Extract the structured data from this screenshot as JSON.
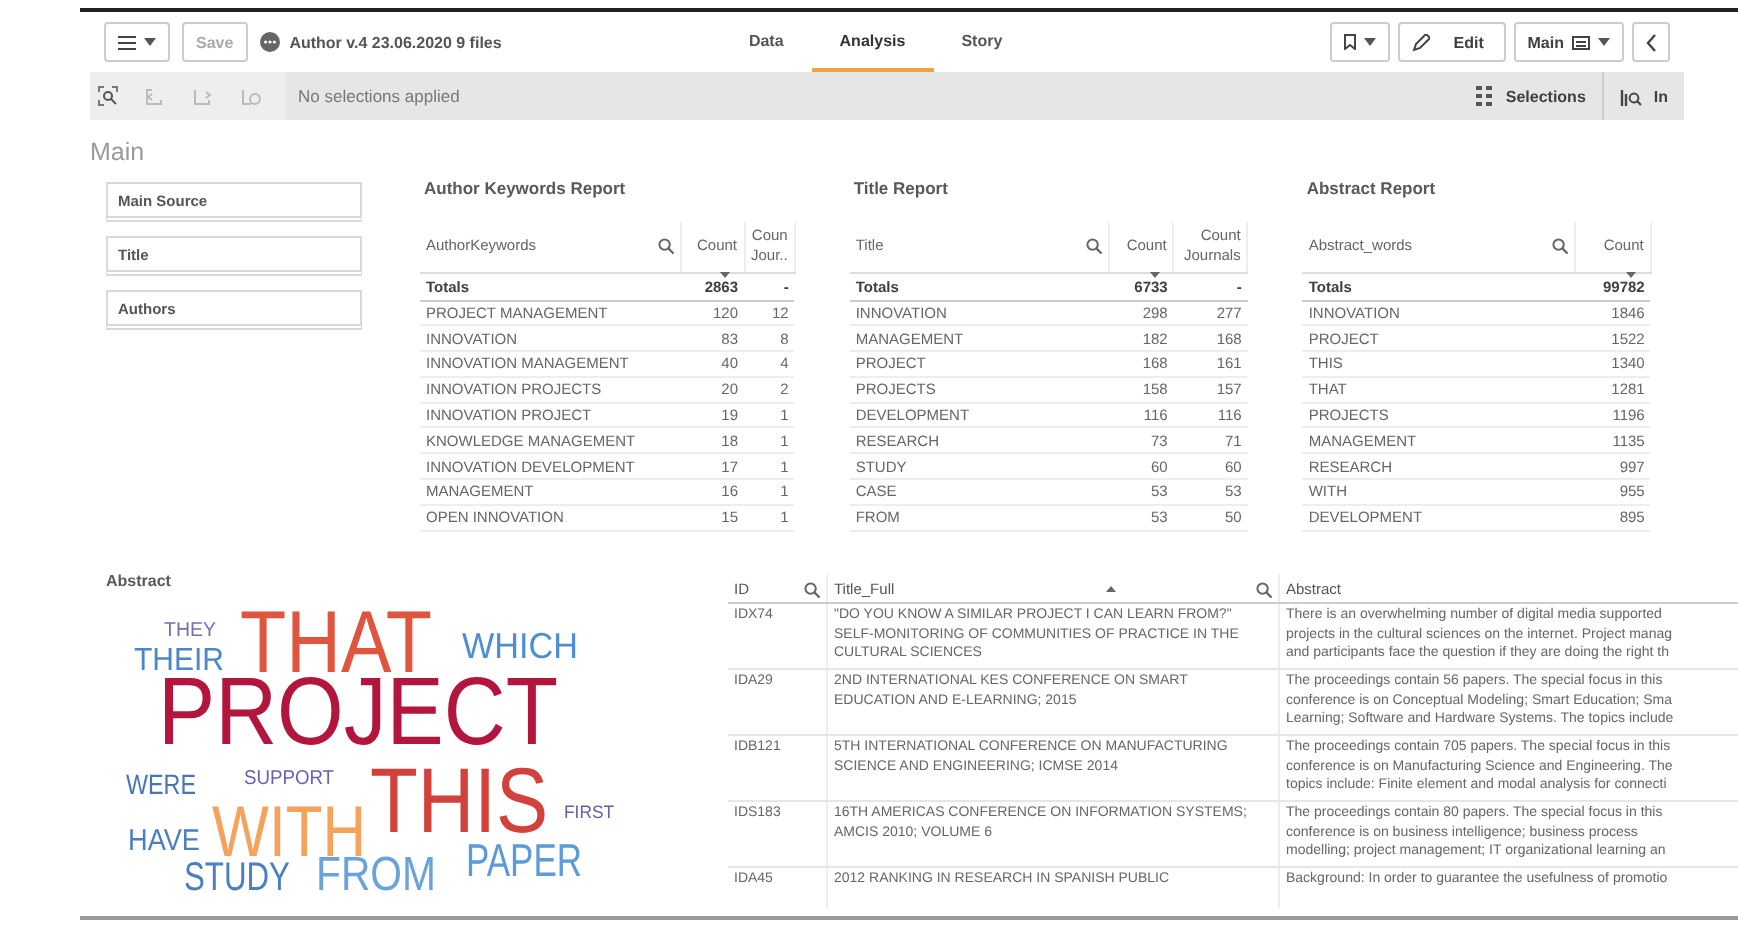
{
  "toolbar": {
    "save": {
      "label": "Save",
      "disabled": true
    },
    "app_title": "Author v.4 23.06.2020 9 files",
    "tabs": [
      {
        "label": "Data",
        "selected": false
      },
      {
        "label": "Analysis",
        "selected": true
      },
      {
        "label": "Story",
        "selected": false
      }
    ],
    "edit": "Edit",
    "sheet": "Main"
  },
  "selection_bar": {
    "status": "No selections applied",
    "selections": "Selections",
    "insights": "In"
  },
  "sheet_title": "Main",
  "filters": [
    "Main Source",
    "Title",
    "Authors"
  ],
  "reports": [
    {
      "title": "Author Keywords Report",
      "columns": [
        "AuthorKeywords",
        "Count",
        "Coun Jour.."
      ],
      "totals": [
        "Totals",
        "2863",
        "-"
      ],
      "rows": [
        [
          "PROJECT MANAGEMENT",
          "120",
          "12"
        ],
        [
          "INNOVATION",
          "83",
          "8"
        ],
        [
          "INNOVATION MANAGEMENT",
          "40",
          "4"
        ],
        [
          "INNOVATION PROJECTS",
          "20",
          "2"
        ],
        [
          "INNOVATION PROJECT",
          "19",
          "1"
        ],
        [
          "KNOWLEDGE MANAGEMENT",
          "18",
          "1"
        ],
        [
          "INNOVATION DEVELOPMENT",
          "17",
          "1"
        ],
        [
          "MANAGEMENT",
          "16",
          "1"
        ],
        [
          "OPEN INNOVATION",
          "15",
          "1"
        ]
      ]
    },
    {
      "title": "Title Report",
      "columns": [
        "Title",
        "Count",
        "Count Journals"
      ],
      "totals": [
        "Totals",
        "6733",
        "-"
      ],
      "rows": [
        [
          "INNOVATION",
          "298",
          "277"
        ],
        [
          "MANAGEMENT",
          "182",
          "168"
        ],
        [
          "PROJECT",
          "168",
          "161"
        ],
        [
          "PROJECTS",
          "158",
          "157"
        ],
        [
          "DEVELOPMENT",
          "116",
          "116"
        ],
        [
          "RESEARCH",
          "73",
          "71"
        ],
        [
          "STUDY",
          "60",
          "60"
        ],
        [
          "CASE",
          "53",
          "53"
        ],
        [
          "FROM",
          "53",
          "50"
        ]
      ]
    },
    {
      "title": "Abstract Report",
      "columns": [
        "Abstract_words",
        "Count"
      ],
      "totals": [
        "Totals",
        "99782"
      ],
      "rows": [
        [
          "INNOVATION",
          "1846"
        ],
        [
          "PROJECT",
          "1522"
        ],
        [
          "THIS",
          "1340"
        ],
        [
          "THAT",
          "1281"
        ],
        [
          "PROJECTS",
          "1196"
        ],
        [
          "MANAGEMENT",
          "1135"
        ],
        [
          "RESEARCH",
          "997"
        ],
        [
          "WITH",
          "955"
        ],
        [
          "DEVELOPMENT",
          "895"
        ]
      ]
    }
  ],
  "word_cloud": {
    "title": "Abstract",
    "words": [
      {
        "text": "THEY",
        "color": "#7a6db3"
      },
      {
        "text": "THEIR",
        "color": "#4b87c8"
      },
      {
        "text": "THAT",
        "color": "#e0553f"
      },
      {
        "text": "WHICH",
        "color": "#4d8fd2"
      },
      {
        "text": "PROJECT",
        "color": "#b3163c"
      },
      {
        "text": "WERE",
        "color": "#4a74b8"
      },
      {
        "text": "SUPPORT",
        "color": "#6662b2"
      },
      {
        "text": "WITH",
        "color": "#f5a35c"
      },
      {
        "text": "THIS",
        "color": "#d2413c"
      },
      {
        "text": "FIRST",
        "color": "#6a5aa8"
      },
      {
        "text": "HAVE",
        "color": "#4a7fc0"
      },
      {
        "text": "PAPER",
        "color": "#5b9bd8"
      },
      {
        "text": "STUDY",
        "color": "#4a7fc0"
      },
      {
        "text": "FROM",
        "color": "#6aa2da"
      }
    ]
  },
  "detail_table": {
    "columns": [
      "ID",
      "Title_Full",
      "Abstract"
    ],
    "rows": [
      {
        "id": "IDX74",
        "title": [
          "\"DO YOU KNOW A SIMILAR PROJECT I CAN LEARN FROM?\"",
          "SELF-MONITORING OF COMMUNITIES OF PRACTICE IN THE",
          "CULTURAL SCIENCES"
        ],
        "abstract": [
          "There is an overwhelming number of digital media supported",
          "projects in the cultural sciences on the internet. Project manag",
          "and participants face the question if they are doing the right th"
        ]
      },
      {
        "id": "IDA29",
        "title": [
          "2ND INTERNATIONAL KES CONFERENCE ON SMART",
          "EDUCATION AND E-LEARNING; 2015"
        ],
        "abstract": [
          "The proceedings contain 56 papers. The special focus in this",
          "conference is on Conceptual Modeling; Smart Education; Sma",
          "Learning; Software and Hardware Systems. The topics include"
        ]
      },
      {
        "id": "IDB121",
        "title": [
          "5TH INTERNATIONAL CONFERENCE ON MANUFACTURING",
          "SCIENCE AND ENGINEERING; ICMSE 2014"
        ],
        "abstract": [
          "The proceedings contain 705 papers. The special focus in this",
          "conference is on Manufacturing Science and Engineering. The",
          "topics include: Finite element and modal analysis for connecti"
        ]
      },
      {
        "id": "IDS183",
        "title": [
          "16TH AMERICAS CONFERENCE ON INFORMATION SYSTEMS;",
          "AMCIS 2010; VOLUME 6"
        ],
        "abstract": [
          "The proceedings contain 80 papers. The special focus in this",
          "conference is on business intelligence; business process",
          "modelling; project management; IT organizational learning an"
        ]
      },
      {
        "id": "IDA45",
        "title": [
          "2012 RANKING IN RESEARCH IN SPANISH PUBLIC"
        ],
        "abstract": [
          "Background: In order to guarantee the usefulness of promotio"
        ]
      }
    ]
  }
}
